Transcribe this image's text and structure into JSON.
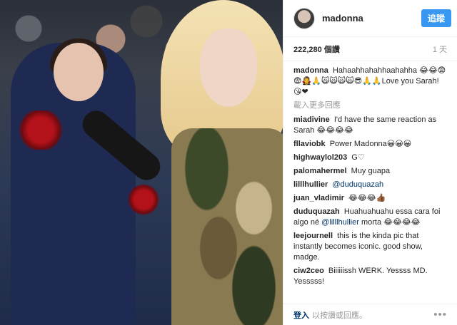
{
  "header": {
    "username": "madonna",
    "follow_label": "追蹤"
  },
  "meta": {
    "likes": "222,280 個讚",
    "time": "1 天"
  },
  "caption": {
    "user": "madonna",
    "text": "Hahaahhahahhaahahha 😂😂😨😨🧛‍♀️🙏🙀🙀🙀🙀😎🙏🙏Love you Sarah! 😘❤"
  },
  "load_more": "載入更多回應",
  "comments": [
    {
      "user": "miadivine",
      "text": "I'd have the same reaction as Sarah 😂😂😂😂"
    },
    {
      "user": "fllaviobk",
      "text": "Power Madonna😀😀😀"
    },
    {
      "user": "highwaylol203",
      "text": "G♡"
    },
    {
      "user": "palomahermel",
      "text": "Muy guapa"
    },
    {
      "user": "lilllhullier",
      "mention": "@duduquazah",
      "text": ""
    },
    {
      "user": "juan_vladimir",
      "text": "😂😂😂👍🏾"
    },
    {
      "user": "duduquazah",
      "text": "Huahuahuahu essa cara foi algo né",
      "mention": "@lilllhullier",
      "text2": "morta 😂😂😂😂"
    },
    {
      "user": "leejournell",
      "text": "this is the kinda pic that instantly becomes iconic. good show, madge."
    },
    {
      "user": "ciw2ceo",
      "text": "Biiiiiissh WERK. Yessss MD. Yesssss!"
    }
  ],
  "footer": {
    "login_label": "登入",
    "rest": "以按讚或回應。",
    "more_icon": "more-options-icon"
  }
}
